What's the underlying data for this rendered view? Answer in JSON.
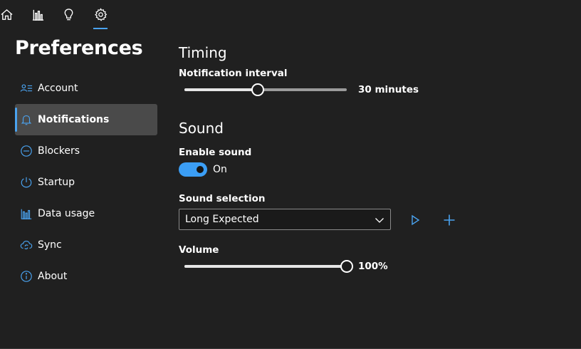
{
  "topnav": {
    "items": [
      {
        "name": "home",
        "icon": "home-icon"
      },
      {
        "name": "stats",
        "icon": "bar-chart-icon"
      },
      {
        "name": "tips",
        "icon": "lightbulb-icon"
      },
      {
        "name": "settings",
        "icon": "gear-icon",
        "active": true
      }
    ],
    "accent": "#4aa3f0"
  },
  "page_title": "Preferences",
  "sidebar": {
    "items": [
      {
        "label": "Account",
        "icon": "account-icon"
      },
      {
        "label": "Notifications",
        "icon": "bell-icon",
        "active": true
      },
      {
        "label": "Blockers",
        "icon": "block-icon"
      },
      {
        "label": "Startup",
        "icon": "power-icon"
      },
      {
        "label": "Data usage",
        "icon": "data-usage-icon"
      },
      {
        "label": "Sync",
        "icon": "cloud-sync-icon"
      },
      {
        "label": "About",
        "icon": "info-icon"
      }
    ]
  },
  "timing": {
    "heading": "Timing",
    "interval_label": "Notification interval",
    "interval_value_text": "30 minutes",
    "interval_fraction": 0.45
  },
  "sound": {
    "heading": "Sound",
    "enable_label": "Enable sound",
    "enable_state_text": "On",
    "enabled": true,
    "selection_label": "Sound selection",
    "selection_value": "Long Expected",
    "volume_label": "Volume",
    "volume_value_text": "100%",
    "volume_fraction": 1.0
  },
  "colors": {
    "background": "#202020",
    "accent": "#3b9ef5",
    "active_item_bg": "#4a4a4a"
  }
}
